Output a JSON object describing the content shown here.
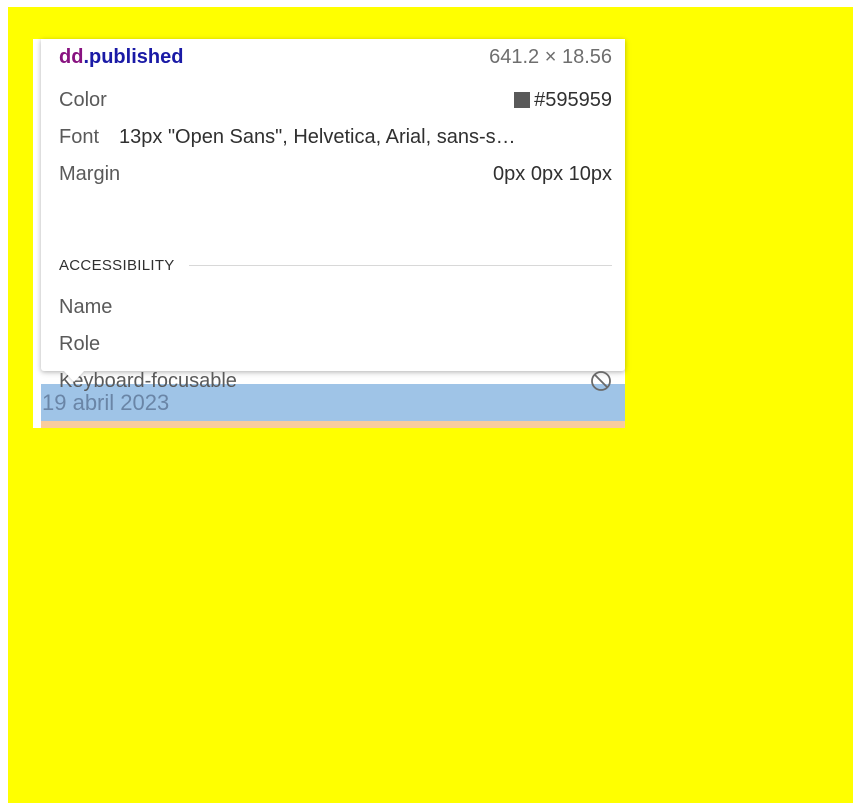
{
  "tooltip": {
    "tag_name": "dd",
    "tag_class": ".published",
    "dimensions": "641.2 × 18.56",
    "color_label": "Color",
    "color_value": "#595959",
    "font_label": "Font",
    "font_value": "13px \"Open Sans\", Helvetica, Arial, sans-s…",
    "margin_label": "Margin",
    "margin_value": "0px 0px 10px",
    "accessibility_heading": "ACCESSIBILITY",
    "name_label": "Name",
    "role_label": "Role",
    "keyboard_label": "Keyboard-focusable",
    "keyboard_icon": "not-allowed-icon"
  },
  "highlighted_element": {
    "text": "19 abril 2023"
  },
  "colors": {
    "page_background": "#ffff00",
    "highlight": "#9fc4e7",
    "margin_overlay": "#f9cc9d",
    "swatch": "#595959"
  }
}
